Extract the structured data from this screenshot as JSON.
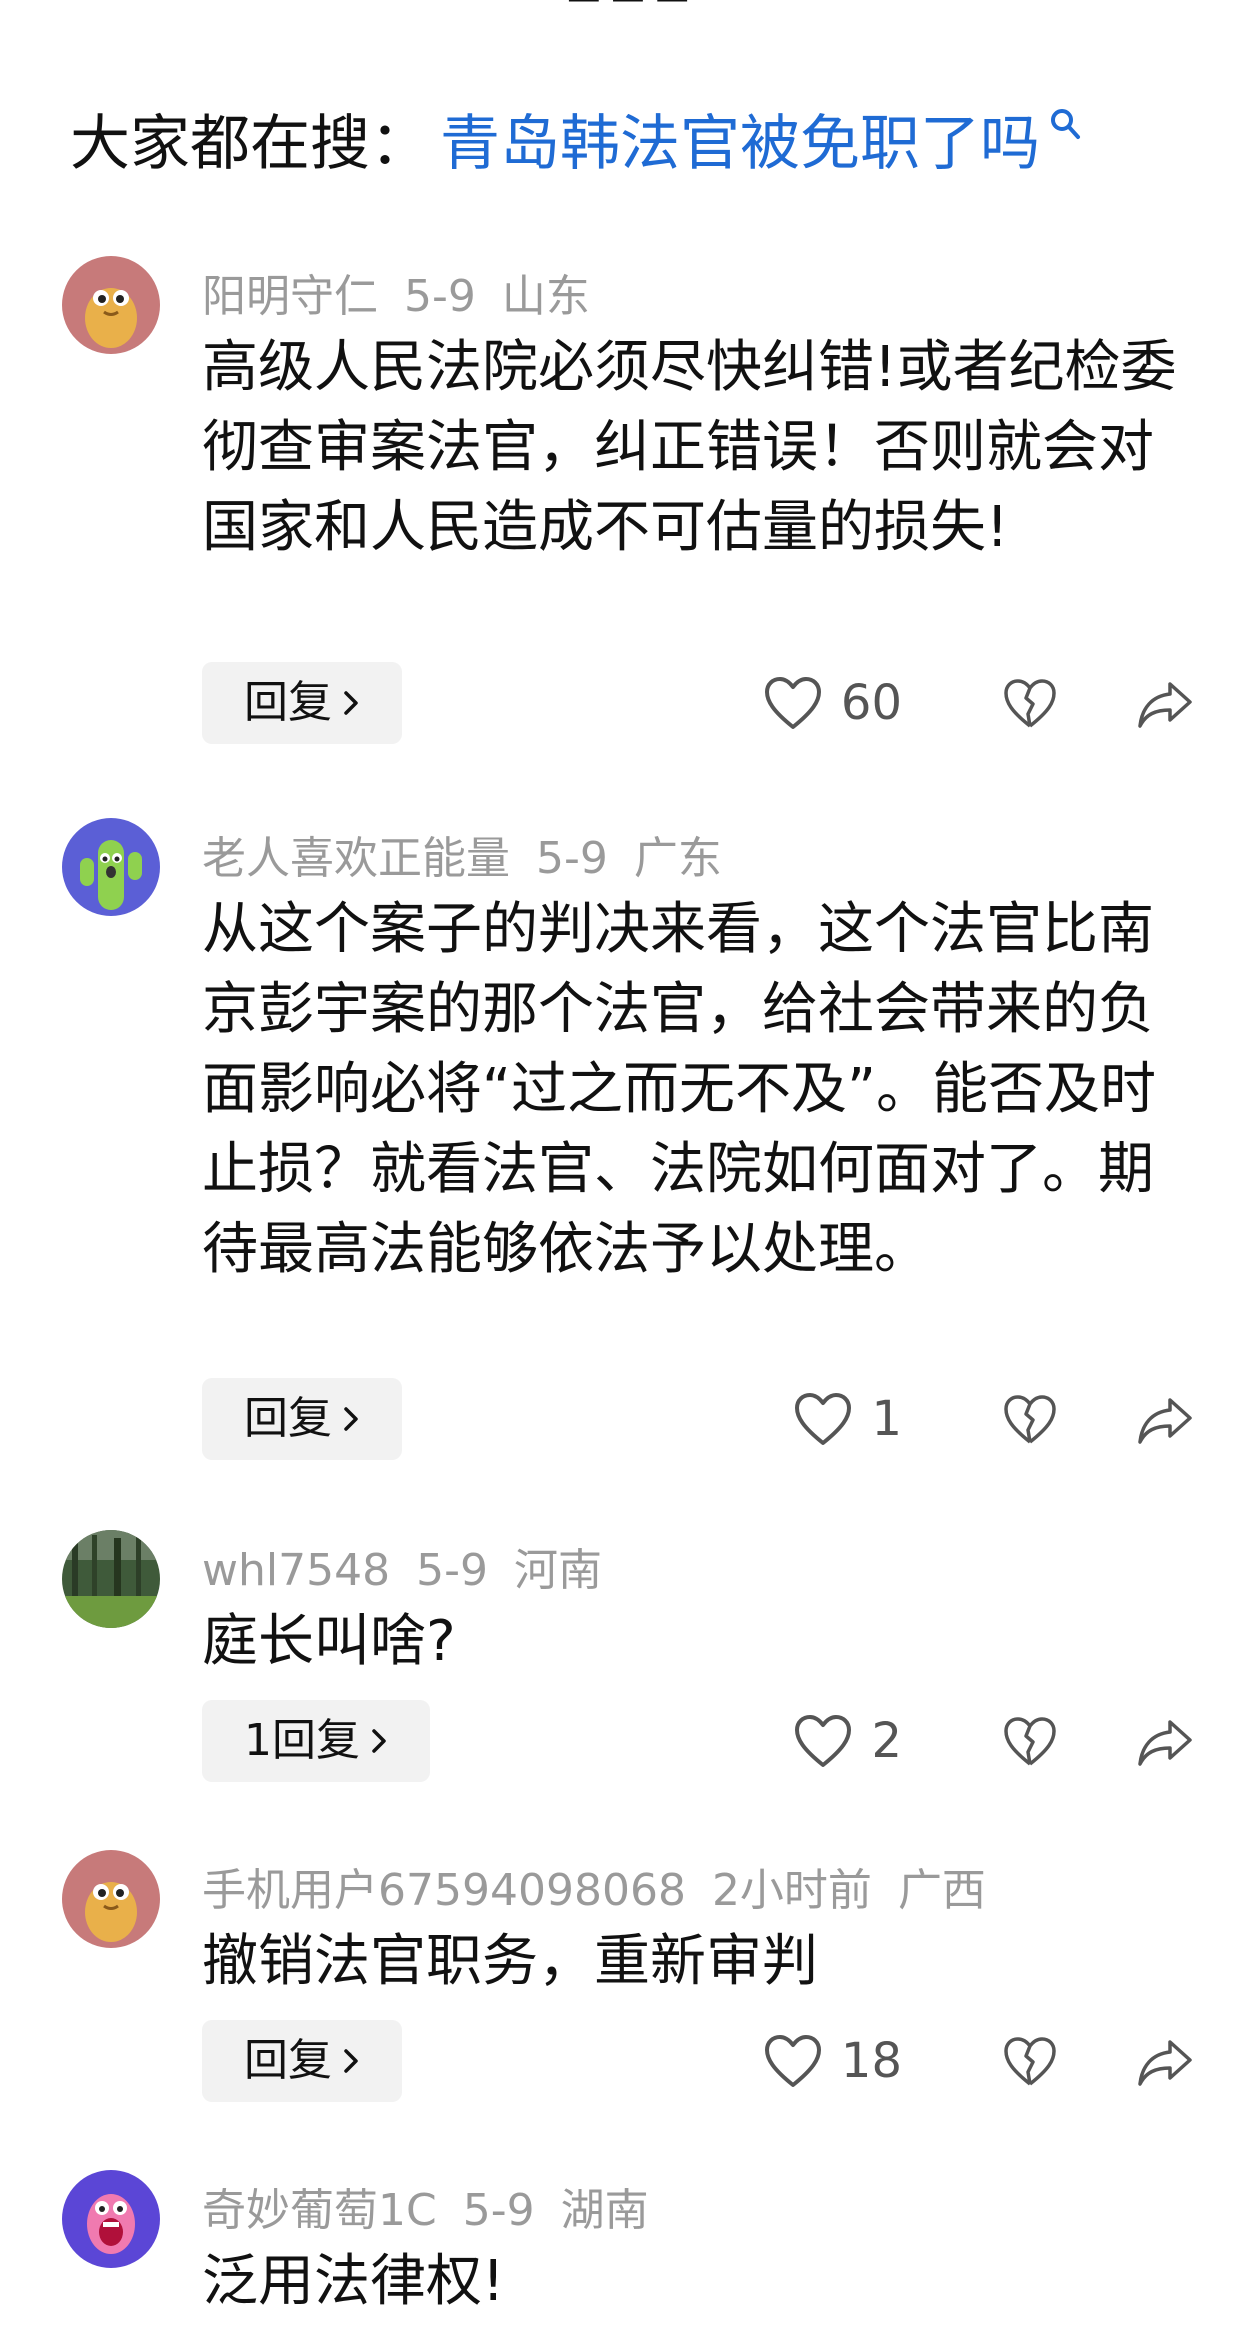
{
  "search": {
    "prefix": "大家都在搜：",
    "query": "青岛韩法官被免职了吗"
  },
  "comments": [
    {
      "username": "阳明守仁",
      "date": "5-9",
      "location": "山东",
      "text": "高级人民法院必须尽快纠错!或者纪检委彻查审案法官，纠正错误！否则就会对国家和人民造成不可估量的损失!",
      "reply_label": "回复",
      "likes": "60",
      "avatar": "peanut-avatar"
    },
    {
      "username": "老人喜欢正能量",
      "date": "5-9",
      "location": "广东",
      "text": "从这个案子的判决来看，这个法官比南京彭宇案的那个法官，给社会带来的负面影响必将“过之而无不及”。能否及时止损？就看法官、法院如何面对了。期待最高法能够依法予以处理。",
      "reply_label": "回复",
      "likes": "1",
      "avatar": "cactus-avatar"
    },
    {
      "username": "whl7548",
      "date": "5-9",
      "location": "河南",
      "text": "庭长叫啥?",
      "reply_label": "1回复",
      "likes": "2",
      "avatar": "forest-photo-avatar"
    },
    {
      "username": "手机用户67594098068",
      "date": "2小时前",
      "location": "广西",
      "text": "撤销法官职务，重新审判",
      "reply_label": "回复",
      "likes": "18",
      "avatar": "peanut-avatar"
    },
    {
      "username": "奇妙葡萄1C",
      "date": "5-9",
      "location": "湖南",
      "text": "泛用法律权!",
      "avatar": "grape-avatar"
    }
  ],
  "colors": {
    "link_blue": "#1f6bd4",
    "meta_gray": "#9a9a9a",
    "reply_bg": "#f2f2f2"
  }
}
